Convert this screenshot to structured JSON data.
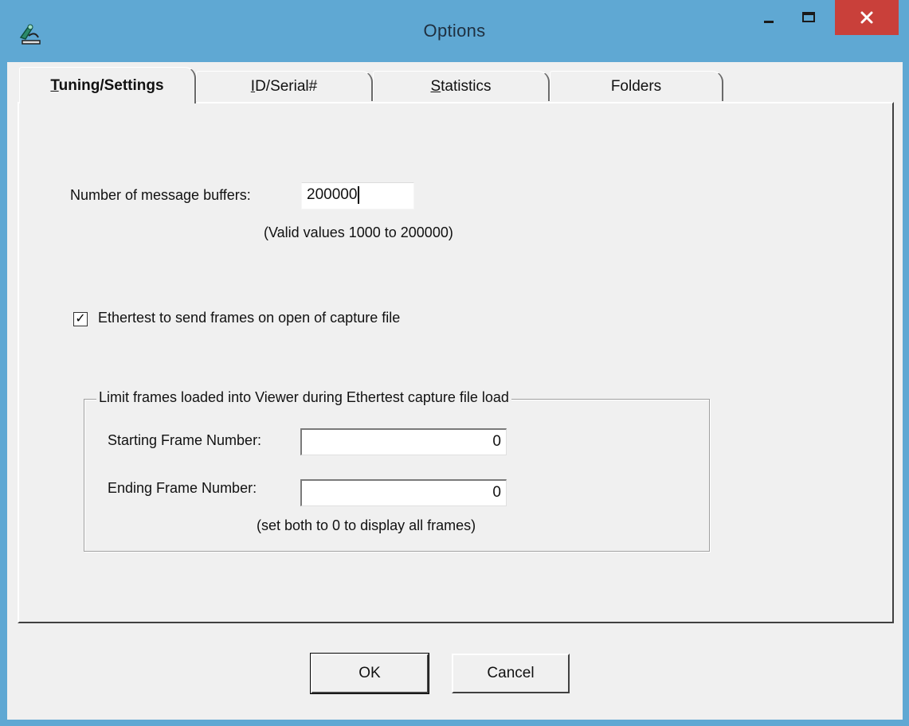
{
  "window": {
    "title": "Options",
    "icon": "app-icon",
    "controls": {
      "minimize": "minimize-icon",
      "maximize": "maximize-icon",
      "close": "close-icon"
    }
  },
  "tabs": [
    {
      "label_u": "T",
      "label_rest": "uning/Settings",
      "active": true
    },
    {
      "label_u": "I",
      "label_rest": "D/Serial#",
      "active": false
    },
    {
      "label_u": "S",
      "label_rest": "tatistics",
      "active": false
    },
    {
      "label_u": "",
      "label_rest": "Folders",
      "active": false
    }
  ],
  "tuning": {
    "buffers_label": "Number of message buffers:",
    "buffers_value": "200000",
    "buffers_hint": "(Valid values 1000 to 200000)",
    "ethertest_checkbox_label": "Ethertest to send frames on open of capture file",
    "ethertest_checked": true,
    "group_title": "Limit frames loaded into Viewer during Ethertest capture file load",
    "start_label": "Starting Frame Number:",
    "start_value": "0",
    "end_label": "Ending Frame Number:",
    "end_value": "0",
    "frames_hint": "(set both to 0 to display all frames)"
  },
  "buttons": {
    "ok": "OK",
    "cancel": "Cancel"
  },
  "colors": {
    "titlebar": "#5fa8d3",
    "close": "#c9403a",
    "dialog": "#f0f0f0"
  }
}
